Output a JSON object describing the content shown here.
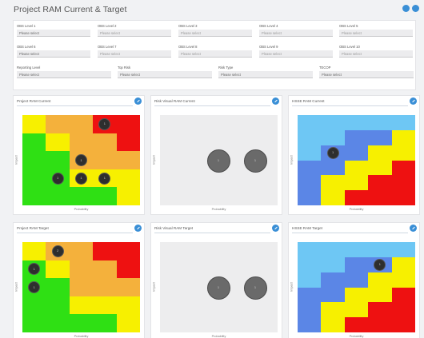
{
  "page": {
    "title": "Project RAM Current & Target"
  },
  "filters": [
    {
      "label": "OBS Level 1",
      "value": "Please select"
    },
    {
      "label": "OBS Level 2",
      "value": "Please select"
    },
    {
      "label": "OBS Level 3",
      "value": "Please select"
    },
    {
      "label": "OBS Level 4",
      "value": "Please select"
    },
    {
      "label": "OBS Level 5",
      "value": "Please select"
    },
    {
      "label": "OBS Level 6",
      "value": "Please select"
    },
    {
      "label": "OBS Level 7",
      "value": "Please select"
    },
    {
      "label": "OBS Level 8",
      "value": "Please select"
    },
    {
      "label": "OBS Level 9",
      "value": "Please select"
    },
    {
      "label": "OBS Level 10",
      "value": "Please select"
    },
    {
      "label": "Reporting Level",
      "value": "Please select"
    },
    {
      "label": "Top Risk",
      "value": "Please select"
    },
    {
      "label": "Risk Type",
      "value": "Please select"
    },
    {
      "label": "TECOP",
      "value": "Please select"
    }
  ],
  "colors": {
    "accent": "#3a8fd6",
    "red": "#ee1111",
    "orange": "#f4b13c",
    "yellow": "#f7f000",
    "green": "#2fe014",
    "light_blue": "#6ec7f4",
    "blue": "#5b86e6",
    "neutral": "#ededee"
  },
  "icons": {
    "header_buttons": [
      "refresh-icon",
      "settings-icon"
    ],
    "panel_button": "expand-icon"
  },
  "panels": [
    {
      "title": "Project RAM Current",
      "ylabel": "Impact",
      "xlabel": "Probability",
      "kind": "ram",
      "bubbles": [
        {
          "row": 0,
          "col": 3,
          "label": "1"
        },
        {
          "row": 2,
          "col": 2,
          "label": "1"
        },
        {
          "row": 3,
          "col": 1,
          "label": "1"
        },
        {
          "row": 3,
          "col": 2,
          "label": "1"
        },
        {
          "row": 3,
          "col": 3,
          "label": "1"
        }
      ]
    },
    {
      "title": "Risk Visual RAM Current",
      "ylabel": "Impact",
      "xlabel": "Probability",
      "kind": "neutral",
      "bubbles": [
        {
          "label": "1",
          "pos": 0
        },
        {
          "label": "1",
          "pos": 1
        }
      ]
    },
    {
      "title": "HSSE RAM Current",
      "ylabel": "Impact",
      "xlabel": "Probability",
      "kind": "hsse",
      "bubbles": [
        {
          "row": 2,
          "col": 1,
          "label": "1"
        }
      ]
    },
    {
      "title": "Project RAM Target",
      "ylabel": "Impact",
      "xlabel": "Probability",
      "kind": "ram",
      "bubbles": [
        {
          "row": 0,
          "col": 1,
          "label": "2"
        },
        {
          "row": 1,
          "col": 0,
          "label": "1"
        },
        {
          "row": 2,
          "col": 0,
          "label": "1"
        }
      ]
    },
    {
      "title": "Risk Visual RAM Target",
      "ylabel": "Impact",
      "xlabel": "Probability",
      "kind": "neutral",
      "bubbles": [
        {
          "label": "1",
          "pos": 0
        },
        {
          "label": "1",
          "pos": 1
        }
      ]
    },
    {
      "title": "HSSE RAM Target",
      "ylabel": "Impact",
      "xlabel": "Probability",
      "kind": "hsse",
      "bubbles": [
        {
          "row": 1,
          "col": 3,
          "label": "1"
        }
      ]
    }
  ],
  "ram_matrix": [
    [
      "y",
      "o",
      "o",
      "r",
      "r"
    ],
    [
      "g",
      "y",
      "o",
      "o",
      "r"
    ],
    [
      "g",
      "g",
      "o",
      "o",
      "o"
    ],
    [
      "g",
      "g",
      "y",
      "y",
      "y"
    ],
    [
      "g",
      "g",
      "g",
      "g",
      "y"
    ]
  ],
  "hsse_matrix": [
    [
      "lb",
      "lb",
      "lb",
      "lb",
      "lb"
    ],
    [
      "lb",
      "lb",
      "b",
      "b",
      "y"
    ],
    [
      "lb",
      "b",
      "b",
      "y",
      "y"
    ],
    [
      "b",
      "b",
      "y",
      "y",
      "r"
    ],
    [
      "b",
      "y",
      "y",
      "r",
      "r"
    ],
    [
      "b",
      "y",
      "r",
      "r",
      "r"
    ]
  ]
}
